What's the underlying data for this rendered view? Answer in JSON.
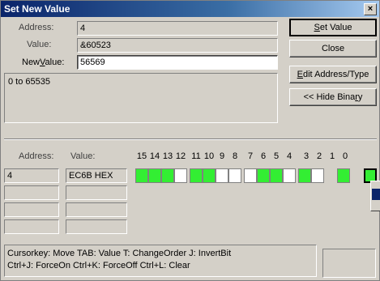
{
  "window": {
    "title": "Set New Value",
    "close_glyph": "×"
  },
  "form": {
    "address_label": "Address:",
    "address_value": "4",
    "value_label": "Value:",
    "value_value": "&60523",
    "newvalue_label_pre": "New",
    "newvalue_label_ul": "V",
    "newvalue_label_post": "alue:",
    "newvalue_value": "56569",
    "range_text": "0 to 65535"
  },
  "buttons": {
    "set_value_ul": "S",
    "set_value_rest": "et Value",
    "close": "Close",
    "edit_ul": "E",
    "edit_rest": "dit Address/Type",
    "hide_binary_pre": "<< Hide Bina",
    "hide_binary_ul": "r",
    "hide_binary_post": "y"
  },
  "binary": {
    "address_header": "Address:",
    "value_header": "Value:",
    "rows": [
      {
        "address": "4",
        "value": "EC6B HEX"
      },
      {
        "address": "",
        "value": ""
      },
      {
        "address": "",
        "value": ""
      },
      {
        "address": "",
        "value": ""
      }
    ],
    "bit_labels": [
      "15",
      "14",
      "13",
      "12",
      "11",
      "10",
      "9",
      "8",
      "7",
      "6",
      "5",
      "4",
      "3",
      "2",
      "1",
      "0"
    ],
    "bits": [
      1,
      1,
      1,
      0,
      1,
      1,
      0,
      0,
      0,
      1,
      1,
      0,
      1,
      0,
      1,
      1
    ]
  },
  "hint": {
    "line1": "Cursorkey: Move   TAB: Value   T: ChangeOrder   J: InvertBit",
    "line2": "Ctrl+J: ForceOn   Ctrl+K: ForceOff   Ctrl+L: Clear"
  },
  "colors": {
    "bit_on": "#33ee33",
    "bit_off": "#ffffff",
    "title_bar": "#0a246a"
  }
}
